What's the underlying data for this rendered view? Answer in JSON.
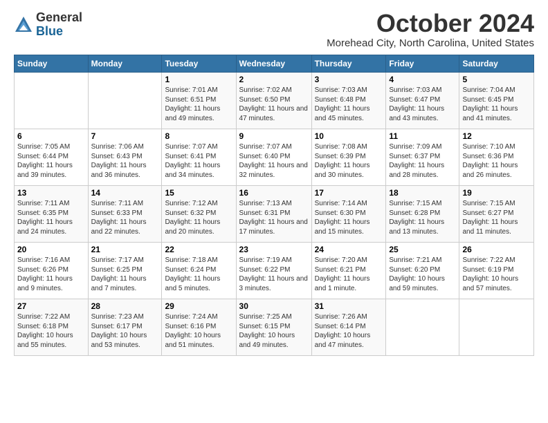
{
  "logo": {
    "general": "General",
    "blue": "Blue"
  },
  "title": "October 2024",
  "location": "Morehead City, North Carolina, United States",
  "days_of_week": [
    "Sunday",
    "Monday",
    "Tuesday",
    "Wednesday",
    "Thursday",
    "Friday",
    "Saturday"
  ],
  "weeks": [
    [
      {
        "day": "",
        "info": ""
      },
      {
        "day": "",
        "info": ""
      },
      {
        "day": "1",
        "info": "Sunrise: 7:01 AM\nSunset: 6:51 PM\nDaylight: 11 hours and 49 minutes."
      },
      {
        "day": "2",
        "info": "Sunrise: 7:02 AM\nSunset: 6:50 PM\nDaylight: 11 hours and 47 minutes."
      },
      {
        "day": "3",
        "info": "Sunrise: 7:03 AM\nSunset: 6:48 PM\nDaylight: 11 hours and 45 minutes."
      },
      {
        "day": "4",
        "info": "Sunrise: 7:03 AM\nSunset: 6:47 PM\nDaylight: 11 hours and 43 minutes."
      },
      {
        "day": "5",
        "info": "Sunrise: 7:04 AM\nSunset: 6:45 PM\nDaylight: 11 hours and 41 minutes."
      }
    ],
    [
      {
        "day": "6",
        "info": "Sunrise: 7:05 AM\nSunset: 6:44 PM\nDaylight: 11 hours and 39 minutes."
      },
      {
        "day": "7",
        "info": "Sunrise: 7:06 AM\nSunset: 6:43 PM\nDaylight: 11 hours and 36 minutes."
      },
      {
        "day": "8",
        "info": "Sunrise: 7:07 AM\nSunset: 6:41 PM\nDaylight: 11 hours and 34 minutes."
      },
      {
        "day": "9",
        "info": "Sunrise: 7:07 AM\nSunset: 6:40 PM\nDaylight: 11 hours and 32 minutes."
      },
      {
        "day": "10",
        "info": "Sunrise: 7:08 AM\nSunset: 6:39 PM\nDaylight: 11 hours and 30 minutes."
      },
      {
        "day": "11",
        "info": "Sunrise: 7:09 AM\nSunset: 6:37 PM\nDaylight: 11 hours and 28 minutes."
      },
      {
        "day": "12",
        "info": "Sunrise: 7:10 AM\nSunset: 6:36 PM\nDaylight: 11 hours and 26 minutes."
      }
    ],
    [
      {
        "day": "13",
        "info": "Sunrise: 7:11 AM\nSunset: 6:35 PM\nDaylight: 11 hours and 24 minutes."
      },
      {
        "day": "14",
        "info": "Sunrise: 7:11 AM\nSunset: 6:33 PM\nDaylight: 11 hours and 22 minutes."
      },
      {
        "day": "15",
        "info": "Sunrise: 7:12 AM\nSunset: 6:32 PM\nDaylight: 11 hours and 20 minutes."
      },
      {
        "day": "16",
        "info": "Sunrise: 7:13 AM\nSunset: 6:31 PM\nDaylight: 11 hours and 17 minutes."
      },
      {
        "day": "17",
        "info": "Sunrise: 7:14 AM\nSunset: 6:30 PM\nDaylight: 11 hours and 15 minutes."
      },
      {
        "day": "18",
        "info": "Sunrise: 7:15 AM\nSunset: 6:28 PM\nDaylight: 11 hours and 13 minutes."
      },
      {
        "day": "19",
        "info": "Sunrise: 7:15 AM\nSunset: 6:27 PM\nDaylight: 11 hours and 11 minutes."
      }
    ],
    [
      {
        "day": "20",
        "info": "Sunrise: 7:16 AM\nSunset: 6:26 PM\nDaylight: 11 hours and 9 minutes."
      },
      {
        "day": "21",
        "info": "Sunrise: 7:17 AM\nSunset: 6:25 PM\nDaylight: 11 hours and 7 minutes."
      },
      {
        "day": "22",
        "info": "Sunrise: 7:18 AM\nSunset: 6:24 PM\nDaylight: 11 hours and 5 minutes."
      },
      {
        "day": "23",
        "info": "Sunrise: 7:19 AM\nSunset: 6:22 PM\nDaylight: 11 hours and 3 minutes."
      },
      {
        "day": "24",
        "info": "Sunrise: 7:20 AM\nSunset: 6:21 PM\nDaylight: 11 hours and 1 minute."
      },
      {
        "day": "25",
        "info": "Sunrise: 7:21 AM\nSunset: 6:20 PM\nDaylight: 10 hours and 59 minutes."
      },
      {
        "day": "26",
        "info": "Sunrise: 7:22 AM\nSunset: 6:19 PM\nDaylight: 10 hours and 57 minutes."
      }
    ],
    [
      {
        "day": "27",
        "info": "Sunrise: 7:22 AM\nSunset: 6:18 PM\nDaylight: 10 hours and 55 minutes."
      },
      {
        "day": "28",
        "info": "Sunrise: 7:23 AM\nSunset: 6:17 PM\nDaylight: 10 hours and 53 minutes."
      },
      {
        "day": "29",
        "info": "Sunrise: 7:24 AM\nSunset: 6:16 PM\nDaylight: 10 hours and 51 minutes."
      },
      {
        "day": "30",
        "info": "Sunrise: 7:25 AM\nSunset: 6:15 PM\nDaylight: 10 hours and 49 minutes."
      },
      {
        "day": "31",
        "info": "Sunrise: 7:26 AM\nSunset: 6:14 PM\nDaylight: 10 hours and 47 minutes."
      },
      {
        "day": "",
        "info": ""
      },
      {
        "day": "",
        "info": ""
      }
    ]
  ]
}
